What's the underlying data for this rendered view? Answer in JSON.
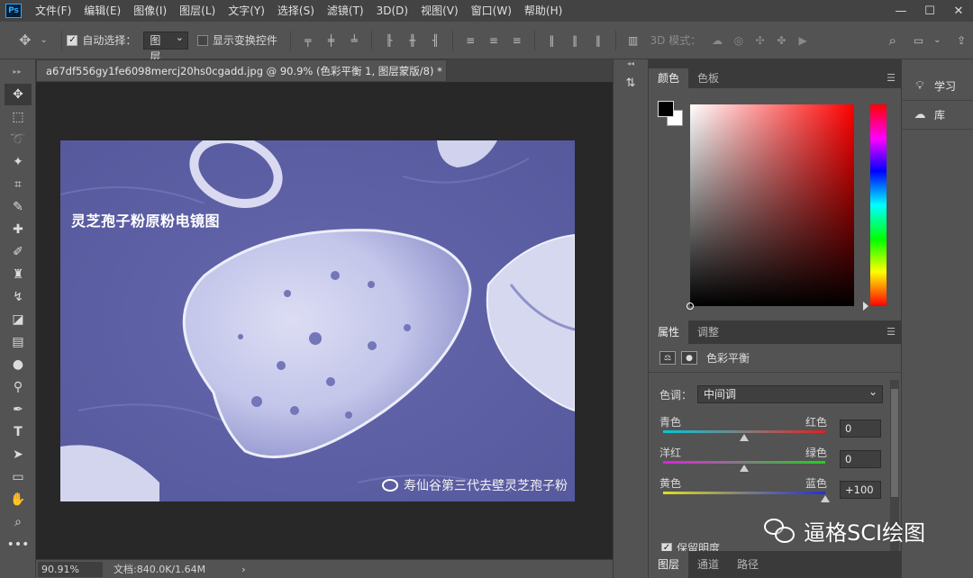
{
  "app": {
    "logo": "Ps",
    "menu": [
      "文件(F)",
      "编辑(E)",
      "图像(I)",
      "图层(L)",
      "文字(Y)",
      "选择(S)",
      "滤镜(T)",
      "3D(D)",
      "视图(V)",
      "窗口(W)",
      "帮助(H)"
    ],
    "window_controls": [
      "—",
      "☐",
      "✕"
    ]
  },
  "options": {
    "auto_select_label": "自动选择：",
    "auto_select_value": "图层",
    "show_transform_label": "显示变换控件",
    "mode_3d_label": "3D 模式："
  },
  "document": {
    "tab_title": "a67df556gy1fe6098mercj20hs0cgadd.jpg @ 90.9% (色彩平衡 1, 图层蒙版/8) *",
    "tab_close": "✕",
    "image_title": "灵芝孢子粉原粉电镜图",
    "image_watermark": "寿仙谷第三代去壁灵芝孢子粉"
  },
  "status": {
    "zoom": "90.91%",
    "doc_size": "文档:840.0K/1.64M",
    "arrow": "›"
  },
  "color_panel": {
    "tabs": [
      "颜色",
      "色板"
    ],
    "fg_color": "#000000",
    "bg_color": "#ffffff"
  },
  "properties": {
    "tabs": [
      "属性",
      "调整"
    ],
    "title": "色彩平衡",
    "tone_label": "色调：",
    "tone_value": "中间调",
    "sliders": [
      {
        "left": "青色",
        "right": "红色",
        "value": "0",
        "level": 0
      },
      {
        "left": "洋红",
        "right": "绿色",
        "value": "0",
        "level": 0
      },
      {
        "left": "黄色",
        "right": "蓝色",
        "value": "+100",
        "level": 100
      }
    ],
    "preserve_label": "保留明度"
  },
  "layers": {
    "tabs": [
      "图层",
      "通道",
      "路径"
    ]
  },
  "side_panel": {
    "items": [
      "学习",
      "库"
    ]
  },
  "overlay": {
    "watermark": "逼格SCI绘图"
  }
}
